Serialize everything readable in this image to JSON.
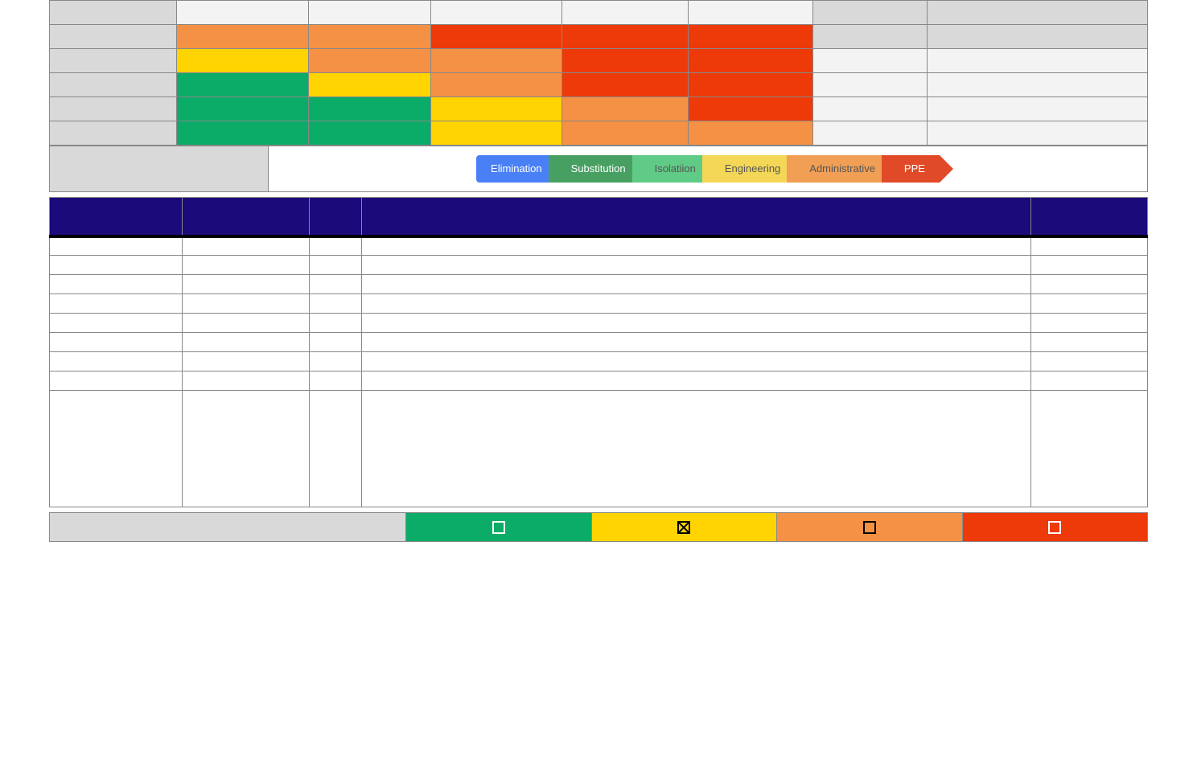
{
  "risk_matrix": {
    "column_headers": [
      "",
      "",
      "",
      "",
      "",
      "",
      "",
      ""
    ],
    "row_labels": [
      "",
      "",
      "",
      "",
      "",
      ""
    ],
    "cells": [
      [
        "lgrey",
        "lgrey",
        "lgrey",
        "lgrey",
        "lgrey",
        "grey",
        "grey"
      ],
      [
        "orange",
        "orange",
        "red",
        "red",
        "red",
        "grey",
        "grey"
      ],
      [
        "yellow",
        "orange",
        "orange",
        "red",
        "red",
        "lgrey",
        "lgrey"
      ],
      [
        "green",
        "yellow",
        "orange",
        "red",
        "red",
        "lgrey",
        "lgrey"
      ],
      [
        "green",
        "green",
        "yellow",
        "orange",
        "red",
        "lgrey",
        "lgrey"
      ],
      [
        "green",
        "green",
        "yellow",
        "orange",
        "orange",
        "lgrey",
        "lgrey"
      ]
    ]
  },
  "hierarchy": {
    "label": "",
    "steps": [
      "Elimination",
      "Substitution",
      "Isolatiion",
      "Engineering",
      "Administrative",
      "PPE"
    ]
  },
  "assessment": {
    "headers": [
      "",
      "",
      "",
      "",
      ""
    ],
    "rows": [
      [
        "",
        "",
        "",
        "",
        ""
      ],
      [
        "",
        "",
        "",
        "",
        ""
      ],
      [
        "",
        "",
        "",
        "",
        ""
      ],
      [
        "",
        "",
        "",
        "",
        ""
      ],
      [
        "",
        "",
        "",
        "",
        ""
      ],
      [
        "",
        "",
        "",
        "",
        ""
      ],
      [
        "",
        "",
        "",
        "",
        ""
      ],
      [
        "",
        "",
        "",
        "",
        ""
      ]
    ],
    "tall_row": [
      "",
      "",
      "",
      "",
      ""
    ]
  },
  "residual": {
    "label": "",
    "options": [
      {
        "label": "",
        "color": "green",
        "checked": false
      },
      {
        "label": "",
        "color": "yellow",
        "checked": true
      },
      {
        "label": "",
        "color": "orange",
        "checked": false
      },
      {
        "label": "",
        "color": "red",
        "checked": false
      }
    ]
  },
  "colors": {
    "green": "#0aac67",
    "yellow": "#ffd400",
    "orange": "#f59144",
    "red": "#ee3908",
    "header_grey": "#d9d9d9",
    "light_grey": "#f3f3f3",
    "navy": "#1a0a7a"
  }
}
